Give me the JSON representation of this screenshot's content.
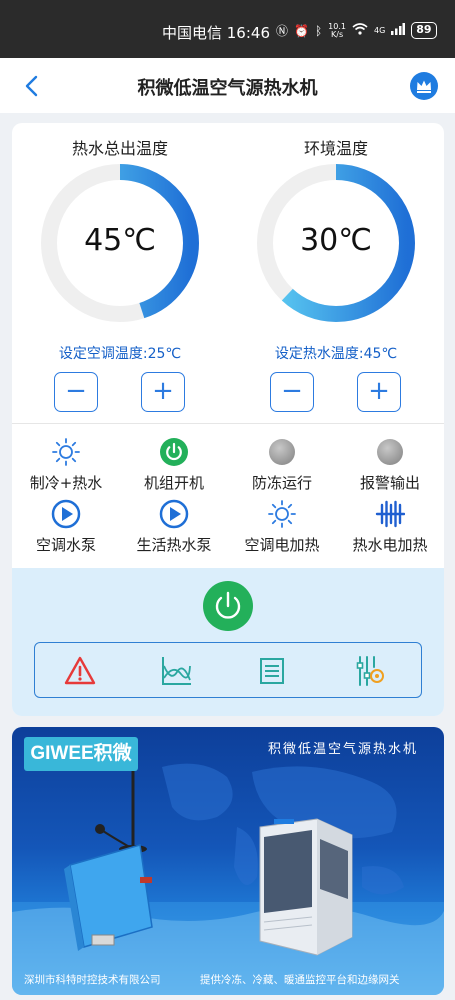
{
  "status_bar": {
    "carrier_time": "中国电信 16:46",
    "net_speed_value": "10.1",
    "net_speed_unit": "K/s",
    "signal_label": "4G",
    "battery": "89"
  },
  "header": {
    "title": "积微低温空气源热水机",
    "back_icon": "chevron-left-icon",
    "crown_icon": "crown-icon"
  },
  "gauges": [
    {
      "title": "热水总出温度",
      "value": "45℃",
      "level": 0.45,
      "setpoint_label": "设定空调温度:25℃",
      "minus": "−",
      "plus": "+"
    },
    {
      "title": "环境温度",
      "value": "30℃",
      "level": 0.62,
      "setpoint_label": "设定热水温度:45℃",
      "minus": "−",
      "plus": "+"
    }
  ],
  "status_items": [
    {
      "label": "制冷+热水",
      "icon": "sun-outline-icon",
      "active": true
    },
    {
      "label": "机组开机",
      "icon": "power-on-icon",
      "active": true
    },
    {
      "label": "防冻运行",
      "icon": "gray-dot-icon",
      "active": false
    },
    {
      "label": "报警输出",
      "icon": "gray-dot-icon",
      "active": false
    },
    {
      "label": "空调水泵",
      "icon": "play-circle-icon",
      "active": true
    },
    {
      "label": "生活热水泵",
      "icon": "play-circle-icon",
      "active": true
    },
    {
      "label": "空调电加热",
      "icon": "sun-outline-icon",
      "active": true
    },
    {
      "label": "热水电加热",
      "icon": "heater-coil-icon",
      "active": true
    }
  ],
  "toolbar": [
    "alarm-warning-icon",
    "trend-chart-icon",
    "list-document-icon",
    "settings-sliders-icon"
  ],
  "colors": {
    "accent_blue": "#1f7ce0",
    "gauge_gradient_start": "#1f6fd6",
    "gauge_gradient_end": "#5fd0f3",
    "gauge_track": "#efefef",
    "power_green": "#23b05a",
    "inactive_gray": "#9a9a9a",
    "panel_bg": "#dbeefb",
    "alarm_red": "#e63a3a"
  },
  "banner": {
    "logo_text": "GIWEE积微",
    "title": "积微低温空气源热水机",
    "company": "深圳市科特时控技术有限公司",
    "slogan": "提供冷冻、冷藏、暖通监控平台和边缘网关"
  }
}
